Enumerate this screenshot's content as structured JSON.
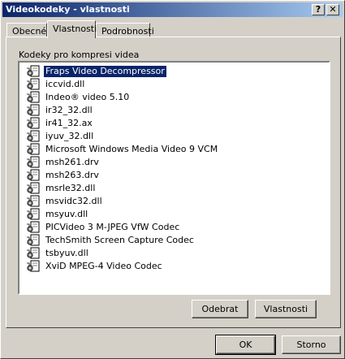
{
  "window": {
    "title": "Videokodeky - vlastnosti",
    "help_button": "?",
    "close_button": "✕"
  },
  "tabs": [
    {
      "label": "Obecné"
    },
    {
      "label": "Vlastnosti"
    },
    {
      "label": "Podrobnosti"
    }
  ],
  "panel": {
    "group_label": "Kodeky pro kompresi videa",
    "codecs": [
      {
        "label": "Fraps Video Decompressor",
        "selected": true
      },
      {
        "label": "iccvid.dll"
      },
      {
        "label": "Indeo® video 5.10"
      },
      {
        "label": "ir32_32.dll"
      },
      {
        "label": "ir41_32.ax"
      },
      {
        "label": "iyuv_32.dll"
      },
      {
        "label": "Microsoft Windows Media Video 9 VCM"
      },
      {
        "label": "msh261.drv"
      },
      {
        "label": "msh263.drv"
      },
      {
        "label": "msrle32.dll"
      },
      {
        "label": "msvidc32.dll"
      },
      {
        "label": "msyuv.dll"
      },
      {
        "label": "PICVideo 3 M-JPEG VfW Codec"
      },
      {
        "label": "TechSmith Screen Capture Codec"
      },
      {
        "label": "tsbyuv.dll"
      },
      {
        "label": "XviD MPEG-4 Video Codec"
      }
    ],
    "remove_button": "Odebrat",
    "properties_button": "Vlastnosti"
  },
  "footer": {
    "ok_button": "OK",
    "cancel_button": "Storno"
  },
  "colors": {
    "titlebar_start": "#0a246a",
    "titlebar_end": "#a6caf0",
    "face": "#d4d0c8",
    "selection": "#0a246a"
  }
}
